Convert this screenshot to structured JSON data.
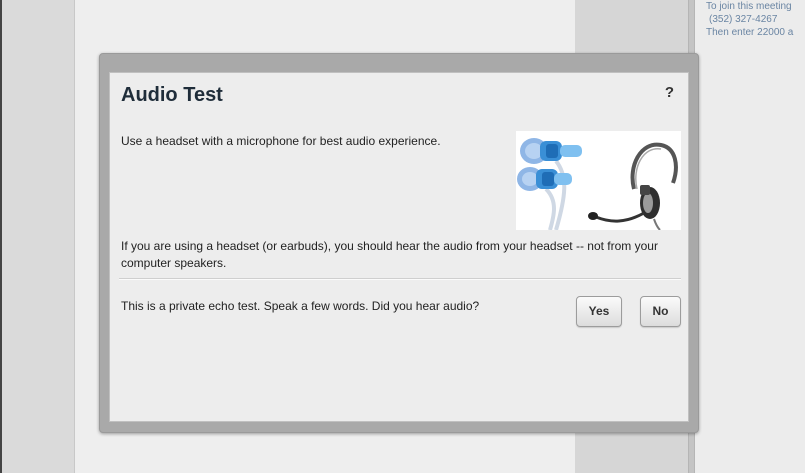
{
  "background": {
    "meeting_info_lines": [
      "To join this meeting",
      "(352) 327-4267",
      "Then enter 22000 a"
    ]
  },
  "dialog": {
    "title": "Audio Test",
    "help_label": "?",
    "intro": "Use a headset with a microphone for best audio experience.",
    "headset_note": "If you are using a headset (or earbuds), you should hear the audio from your headset -- not from your computer speakers.",
    "echo_prompt": "This is a private echo test.  Speak a few words.  Did you hear audio?",
    "yes_label": "Yes",
    "no_label": "No"
  },
  "colors": {
    "title": "#1f2d3a",
    "earbud_accent": "#3a8fd6",
    "meeting_text": "#6a85a3"
  }
}
